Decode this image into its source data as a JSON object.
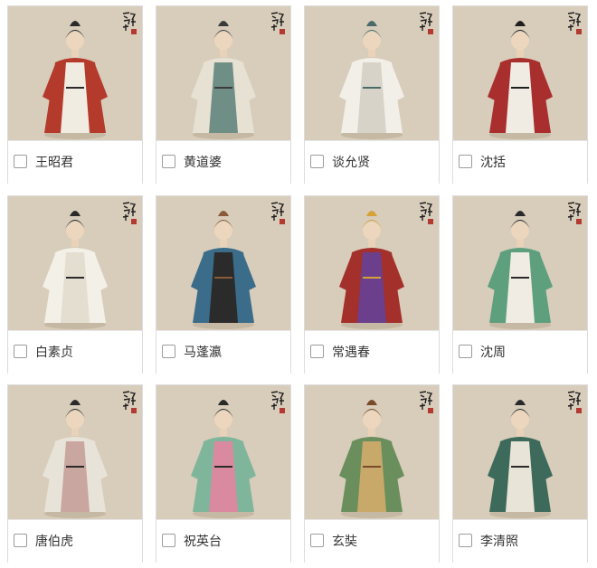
{
  "cards": [
    {
      "name": "王昭君",
      "figure": "red-cloak-woman-icon",
      "colors": {
        "robe": "#b43a2c",
        "inner": "#f1ece2",
        "accent": "#2a2a2a"
      },
      "checked": false
    },
    {
      "name": "黄道婆",
      "figure": "weaver-woman-icon",
      "colors": {
        "robe": "#e7e1d3",
        "inner": "#6f8f86",
        "accent": "#3b3b3b"
      },
      "checked": false
    },
    {
      "name": "谈允贤",
      "figure": "physician-woman-icon",
      "colors": {
        "robe": "#f2efe8",
        "inner": "#d7d3c8",
        "accent": "#4a6b6a"
      },
      "checked": false
    },
    {
      "name": "沈括",
      "figure": "scholar-official-icon",
      "colors": {
        "robe": "#a92f2e",
        "inner": "#f0ece3",
        "accent": "#1f1f1f"
      },
      "checked": false
    },
    {
      "name": "白素贞",
      "figure": "white-robe-woman-icon",
      "colors": {
        "robe": "#f3f0e8",
        "inner": "#e4ded1",
        "accent": "#2a2a2a"
      },
      "checked": false
    },
    {
      "name": "马蓬瀛",
      "figure": "astronomer-icon",
      "colors": {
        "robe": "#3b6c8a",
        "inner": "#2b2b2b",
        "accent": "#8a5a3a"
      },
      "checked": false
    },
    {
      "name": "常遇春",
      "figure": "armored-general-icon",
      "colors": {
        "robe": "#a3302a",
        "inner": "#6b3f8c",
        "accent": "#d4a237"
      },
      "checked": false
    },
    {
      "name": "沈周",
      "figure": "painter-scholar-icon",
      "colors": {
        "robe": "#5e9f7e",
        "inner": "#f0ece3",
        "accent": "#2a2a2a"
      },
      "checked": false
    },
    {
      "name": "唐伯虎",
      "figure": "poet-scholar-icon",
      "colors": {
        "robe": "#e8e3d8",
        "inner": "#c9a6a0",
        "accent": "#2a2a2a"
      },
      "checked": false
    },
    {
      "name": "祝英台",
      "figure": "flower-robe-woman-icon",
      "colors": {
        "robe": "#7fb69b",
        "inner": "#d98aa0",
        "accent": "#2a2a2a"
      },
      "checked": false
    },
    {
      "name": "玄奘",
      "figure": "pilgrim-monk-icon",
      "colors": {
        "robe": "#6a8f5c",
        "inner": "#c9a96a",
        "accent": "#7a4a2a"
      },
      "checked": false
    },
    {
      "name": "李清照",
      "figure": "poetess-icon",
      "colors": {
        "robe": "#3d6a5a",
        "inner": "#e9e4d8",
        "accent": "#2a2a2a"
      },
      "checked": false
    }
  ],
  "art_background": "#d8cdbb",
  "seal_color": "#b23a32"
}
